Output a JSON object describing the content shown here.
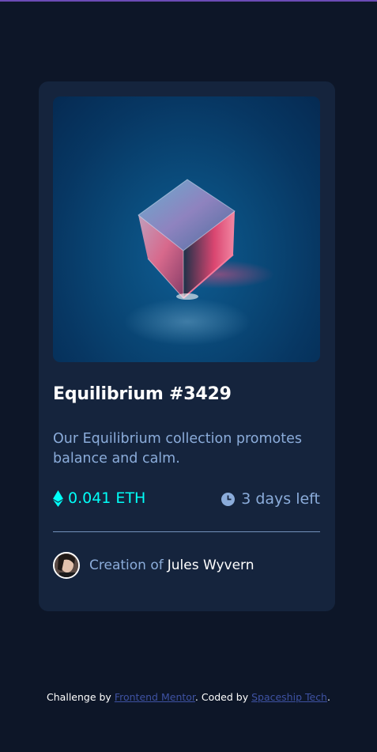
{
  "card": {
    "image_alt": "Equilibrium",
    "title": "Equilibrium #3429",
    "description": "Our Equilibrium collection promotes balance and calm.",
    "price": "0.041 ETH",
    "price_icon": "ethereum-icon",
    "time_left": "3 days left",
    "time_icon": "clock-icon",
    "creator_prefix": "Creation of",
    "creator_name": "Jules Wyvern"
  },
  "footer": {
    "challenge_prefix": "Challenge by",
    "challenge_link": "Frontend Mentor",
    "coded_prefix": ". Coded by",
    "coded_link": "Spaceship Tech",
    "suffix": "."
  },
  "colors": {
    "page_bg": "#0d1628",
    "card_bg": "#15243d",
    "accent_cyan": "#00fff8",
    "soft_blue": "#8bacda",
    "link": "#3e52a3"
  }
}
